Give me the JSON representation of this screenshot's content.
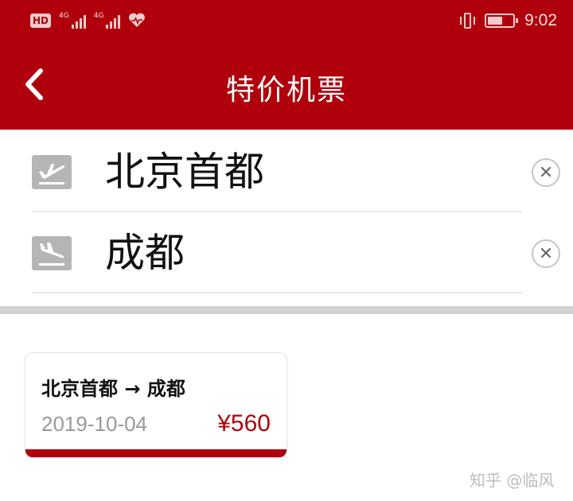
{
  "status_bar": {
    "hd_badge": "HD",
    "sim1_label": "4G",
    "sim2_label": "4G",
    "time": "9:02",
    "battery_level": 0.6,
    "icons": [
      "hd-icon",
      "signal-icon",
      "signal-icon",
      "heart-icon",
      "vibrate-icon",
      "battery-icon"
    ]
  },
  "header": {
    "title": "特价机票",
    "back_icon": "chevron-left-icon",
    "background_color": "#b0000c"
  },
  "search": {
    "from": {
      "value": "北京首都",
      "icon": "plane-takeoff-icon",
      "clear_icon": "close-icon"
    },
    "to": {
      "value": "成都",
      "icon": "plane-landing-icon",
      "clear_icon": "close-icon"
    }
  },
  "results": [
    {
      "route": "北京首都 → 成都",
      "date": "2019-10-04",
      "price": "¥560"
    }
  ],
  "watermark": "知乎 @临风",
  "colors": {
    "accent": "#b0000c",
    "icon_gray": "#b5b5b5",
    "muted_text": "#999999"
  }
}
